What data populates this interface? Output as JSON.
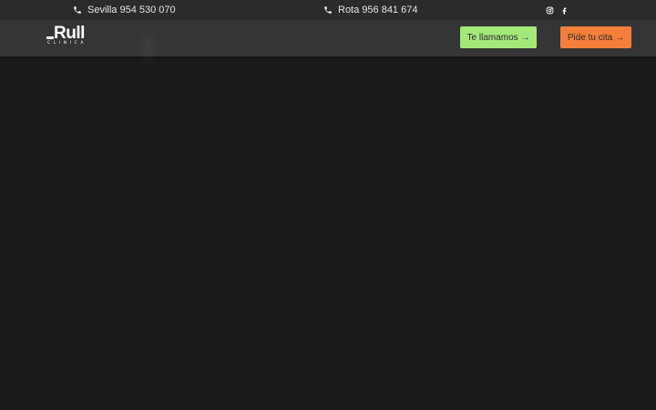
{
  "topbar": {
    "phones": [
      {
        "label": "Sevilla 954 530 070",
        "icon": "phone-icon"
      },
      {
        "label": "Rota 956 841 674",
        "icon": "phone-icon"
      }
    ],
    "social": [
      {
        "icon": "instagram-icon"
      },
      {
        "icon": "facebook-icon"
      }
    ]
  },
  "header": {
    "logo": {
      "word": "Rull",
      "sub": "CLINICA"
    },
    "call_button": "Te llamamos →",
    "appointment_button": "Pide tu cita →"
  },
  "colors": {
    "topbar_bg": "#2b2b2c",
    "header_bg": "#353536",
    "page_bg": "#1b1b1c",
    "call_button": "#a4e87a",
    "appointment_button": "#f47f3a"
  }
}
